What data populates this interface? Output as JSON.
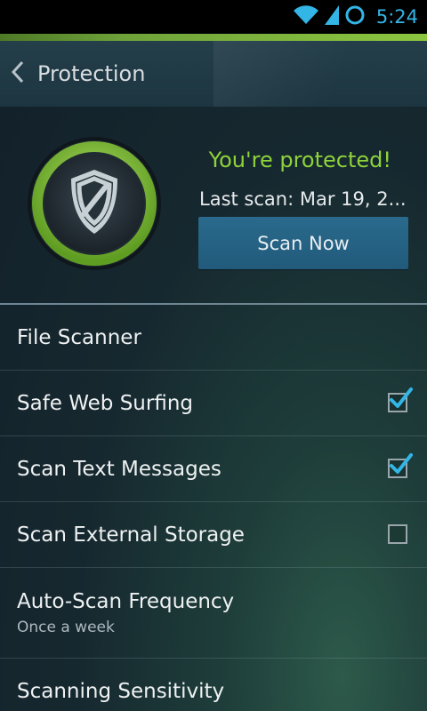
{
  "status_bar": {
    "time": "5:24",
    "icons": [
      "wifi-icon",
      "signal-icon",
      "sync-circle-icon"
    ]
  },
  "action_bar": {
    "back_icon": "chevron-left-icon",
    "title": "Protection"
  },
  "hero": {
    "icon": "shield-icon",
    "status": "You're protected!",
    "last_scan": "Last scan: Mar 19, 2...",
    "scan_button": "Scan Now"
  },
  "settings": [
    {
      "label": "File Scanner",
      "sub": "",
      "checkbox": null
    },
    {
      "label": "Safe Web Surfing",
      "sub": "",
      "checkbox": true
    },
    {
      "label": "Scan Text Messages",
      "sub": "",
      "checkbox": true
    },
    {
      "label": "Scan External Storage",
      "sub": "",
      "checkbox": false
    },
    {
      "label": "Auto-Scan Frequency",
      "sub": "Once a week",
      "checkbox": null
    },
    {
      "label": "Scanning Sensitivity",
      "sub": "",
      "checkbox": null
    }
  ],
  "colors": {
    "accent_green": "#8ed33a",
    "button_blue": "#2a6a8c",
    "check_blue": "#33b5e5",
    "status_blue": "#33b5e5"
  }
}
